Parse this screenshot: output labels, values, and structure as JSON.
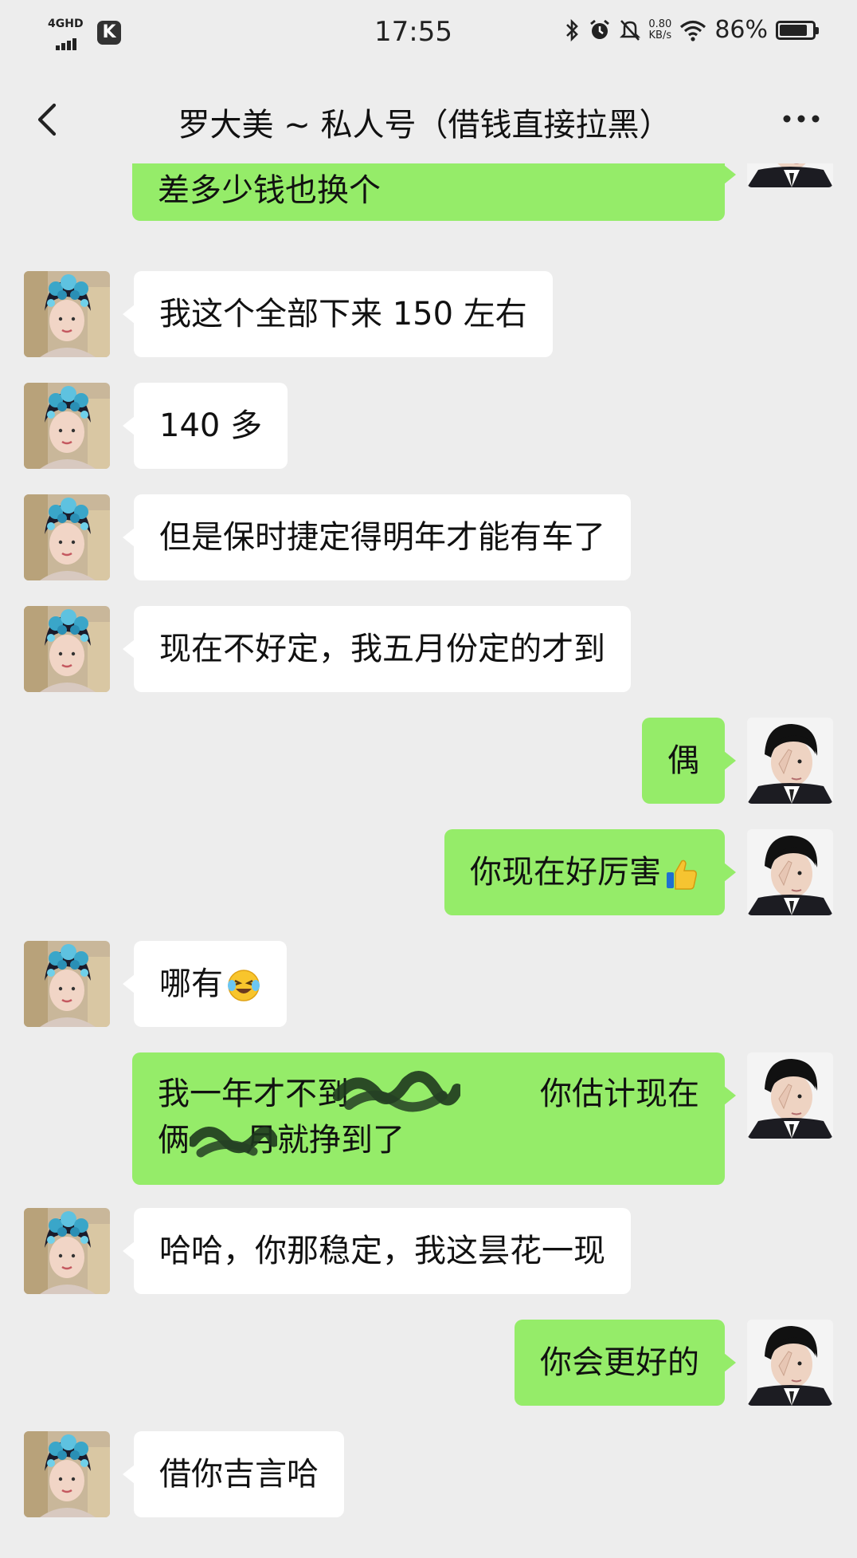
{
  "status_bar": {
    "network": "4GHD",
    "carrier_icon_letter": "K",
    "time": "17:55",
    "speed_value": "0.80",
    "speed_unit": "KB/s",
    "battery_percent": "86%",
    "battery_level": 0.86
  },
  "nav": {
    "title": "罗大美 ~ 私人号（借钱直接拉黑）",
    "back_icon": "chevron-left-icon",
    "more_icon": "more-dots-icon"
  },
  "messages": [
    {
      "side": "right",
      "text": "差多少钱也换个"
    },
    {
      "side": "left",
      "text": "我这个全部下来 150 左右"
    },
    {
      "side": "left",
      "text": "140 多"
    },
    {
      "side": "left",
      "text": "但是保时捷定得明年才能有车了"
    },
    {
      "side": "left",
      "text": "现在不好定，我五月份定的才到"
    },
    {
      "side": "right",
      "text": "偶"
    },
    {
      "side": "right",
      "text": "你现在好厉害",
      "emoji": "thumbs-up-icon"
    },
    {
      "side": "left",
      "text": "哪有",
      "emoji": "laugh-cry-emoji-icon"
    },
    {
      "side": "right",
      "line1": "我一年才不到",
      "line1_end": "你估计现在",
      "line2_start": "俩",
      "line2_end": "月就挣到了"
    },
    {
      "side": "left",
      "text": "哈哈，你那稳定，我这昙花一现"
    },
    {
      "side": "right",
      "text": "你会更好的"
    },
    {
      "side": "left",
      "text": "借你吉言哈"
    }
  ],
  "colors": {
    "background": "#ededed",
    "sent_bubble": "#95ec69",
    "received_bubble": "#ffffff"
  }
}
